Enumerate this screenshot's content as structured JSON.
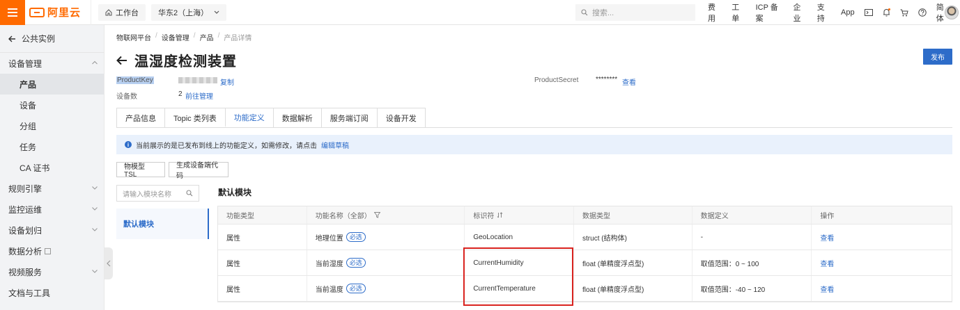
{
  "topbar": {
    "logo_text": "阿里云",
    "workbench_label": "工作台",
    "region_label": "华东2（上海）",
    "search_placeholder": "搜索...",
    "links": [
      "费用",
      "工单",
      "ICP 备案",
      "企业",
      "支持",
      "App"
    ],
    "lang_label": "简体",
    "brand_color": "#ff6a00"
  },
  "sidebar": {
    "back_label": "公共实例",
    "items": [
      {
        "label": "设备管理",
        "type": "group",
        "expanded": true
      },
      {
        "label": "产品",
        "type": "sub",
        "active": true
      },
      {
        "label": "设备",
        "type": "sub"
      },
      {
        "label": "分组",
        "type": "sub"
      },
      {
        "label": "任务",
        "type": "sub"
      },
      {
        "label": "CA 证书",
        "type": "sub"
      },
      {
        "label": "规则引擎",
        "type": "group"
      },
      {
        "label": "监控运维",
        "type": "group"
      },
      {
        "label": "设备划归",
        "type": "group"
      },
      {
        "label": "数据分析",
        "type": "group"
      },
      {
        "label": "视频服务",
        "type": "group"
      },
      {
        "label": "文档与工具",
        "type": "group"
      }
    ]
  },
  "breadcrumb": {
    "items": [
      "物联网平台",
      "设备管理",
      "产品"
    ],
    "current": "产品详情"
  },
  "page": {
    "title": "温湿度检测装置",
    "publish_label": "发布",
    "accent_color": "#2d6cc9"
  },
  "meta": {
    "product_key_label": "ProductKey",
    "copy_label": "复制",
    "device_count_label": "设备数",
    "device_count": "2",
    "manage_label": "前往管理",
    "product_secret_label": "ProductSecret",
    "product_secret_masked": "********",
    "view_label": "查看"
  },
  "tabs": [
    "产品信息",
    "Topic 类列表",
    "功能定义",
    "数据解析",
    "服务端订阅",
    "设备开发"
  ],
  "active_tab_index": 2,
  "notice": {
    "text": "当前展示的是已发布到线上的功能定义，如需修改，请点击",
    "link": "编辑草稿"
  },
  "buttons": {
    "tsl": "物模型 TSL",
    "gen_code": "生成设备端代码"
  },
  "module_panel": {
    "search_placeholder": "请输入模块名称",
    "items": [
      "默认模块"
    ]
  },
  "section_title": "默认模块",
  "table": {
    "headers": [
      "功能类型",
      "功能名称（全部）",
      "标识符",
      "数据类型",
      "数据定义",
      "操作"
    ],
    "rows": [
      {
        "type": "属性",
        "name": "地理位置",
        "tag": "必选",
        "identifier": "GeoLocation",
        "data_type": "struct (结构体)",
        "definition": "-",
        "op": "查看"
      },
      {
        "type": "属性",
        "name": "当前湿度",
        "tag": "必选",
        "identifier": "CurrentHumidity",
        "data_type": "float (单精度浮点型)",
        "definition": "取值范围：0 ~ 100",
        "op": "查看"
      },
      {
        "type": "属性",
        "name": "当前温度",
        "tag": "必选",
        "identifier": "CurrentTemperature",
        "data_type": "float (单精度浮点型)",
        "definition": "取值范围：-40 ~ 120",
        "op": "查看"
      }
    ]
  }
}
